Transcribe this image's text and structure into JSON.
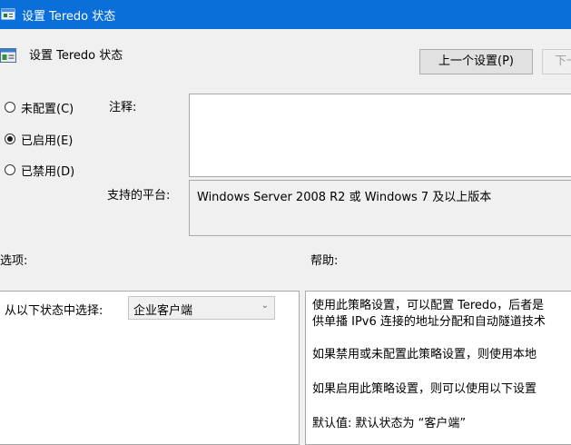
{
  "window": {
    "title": "设置 Teredo 状态"
  },
  "header": {
    "title": "设置 Teredo 状态"
  },
  "buttons": {
    "prev_label": "上一个设置(P)",
    "next_label": "下一"
  },
  "radios": [
    {
      "label": "未配置(C)",
      "selected": false
    },
    {
      "label": "已启用(E)",
      "selected": true
    },
    {
      "label": "已禁用(D)",
      "selected": false
    }
  ],
  "labels": {
    "comment": "注释:",
    "platform": "支持的平台:",
    "options": "选项:",
    "help": "帮助:"
  },
  "comment": {
    "value": ""
  },
  "platform": {
    "value": "Windows Server 2008 R2 或 Windows 7 及以上版本"
  },
  "options": {
    "select_label": "从以下状态中选择:",
    "select_value": "企业客户端"
  },
  "help": {
    "lines": [
      "使用此策略设置，可以配置 Teredo，后者是",
      "供单播 IPv6 连接的地址分配和自动隧道技术",
      "如果禁用或未配置此策略设置，则使用本地",
      "如果启用此策略设置，则可以使用以下设置",
      "默认值: 默认状态为 “客户端”"
    ]
  },
  "colors": {
    "titlebar": "#0a6fd8"
  },
  "icons": {
    "app": "policy-setting-icon",
    "header": "policy-setting-icon"
  }
}
